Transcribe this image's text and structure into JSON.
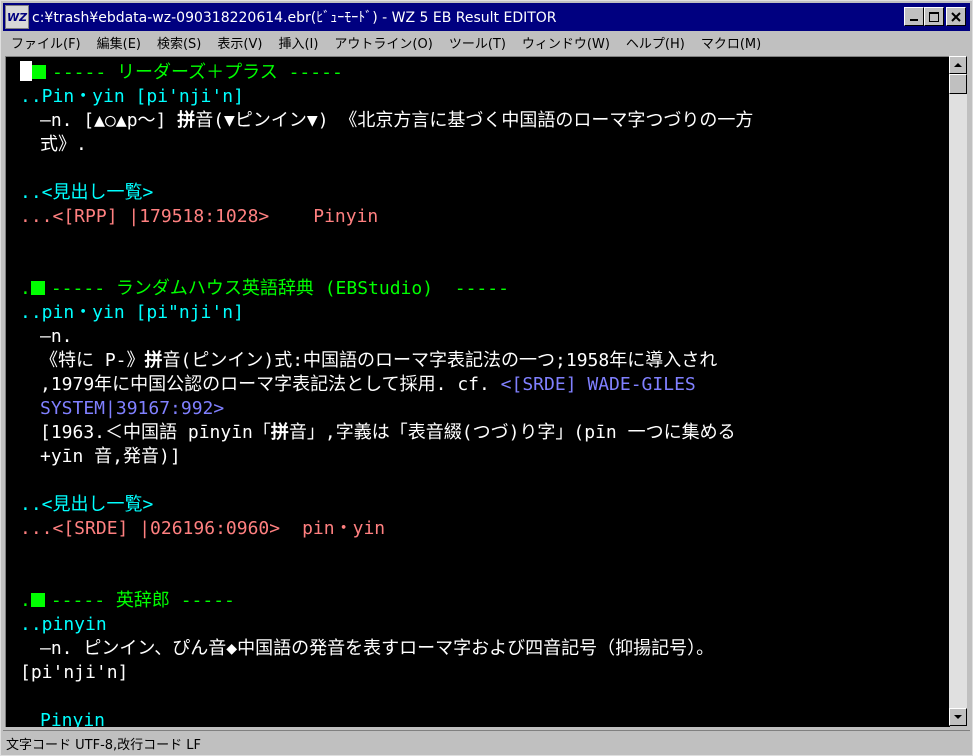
{
  "window": {
    "title": "c:¥trash¥ebdata-wz-090318220614.ebr(ﾋﾞｭｰﾓｰﾄﾞ) - WZ 5 EB Result EDITOR",
    "icon": "wz-app-icon",
    "icon_text": "WZ"
  },
  "menu": [
    {
      "label": "ファイル(F)"
    },
    {
      "label": "編集(E)"
    },
    {
      "label": "検索(S)"
    },
    {
      "label": "表示(V)"
    },
    {
      "label": "挿入(I)"
    },
    {
      "label": "アウトライン(O)"
    },
    {
      "label": "ツール(T)"
    },
    {
      "label": "ウィンドウ(W)"
    },
    {
      "label": "ヘルプ(H)"
    },
    {
      "label": "マクロ(M)"
    }
  ],
  "content": {
    "l1": "----- リーダーズ＋プラス -----",
    "l2": "..Pin・yin [pi'nji'n]",
    "l3a": "―n. [▲○▲p～] ",
    "l3b": "拼",
    "l3c": "音(▼ピンイン▼) 《北京方言に基づく中国語のローマ字つづりの一方",
    "l4": "式》.",
    "l5": "..<見出し一覧>",
    "l6a": "...<[RPP] |179518:1028>",
    "l6b": "Pinyin",
    "l7": "----- ランダムハウス英語辞典 (EBStudio)  -----",
    "l8": "..pin・yin [pi\"nji'n]",
    "l9": "―n.",
    "l10a": "《特に P-》",
    "l10b": "拼",
    "l10c": "音(ピンイン)式:中国語のローマ字表記法の一つ;1958年に導入され",
    "l11a": ",1979年に中国公認のローマ字表記法として採用. cf. ",
    "l11b": "<[SRDE] WADE-GILES",
    "l12": "SYSTEM|39167:992>",
    "l13a": "[1963.＜中国語 pīnyīn「",
    "l13b": "拼",
    "l13c": "音」,字義は「表音綴(つづ)り字」(pīn 一つに集める",
    "l14": "+yīn 音,発音)]",
    "l15": "..<見出し一覧>",
    "l16a": "...<[SRDE] |026196:0960>",
    "l16b": "pin・yin",
    "l17": "----- 英辞郎 -----",
    "l18": "..pinyin",
    "l19": "―n. ピンイン、ぴん音◆中国語の発音を表すローマ字および四音記号（抑揚記号）。",
    "l20": "[pi'nji'n]",
    "l21": "Pinyin"
  },
  "status": {
    "text": "文字コード UTF-8,改行コード LF"
  }
}
